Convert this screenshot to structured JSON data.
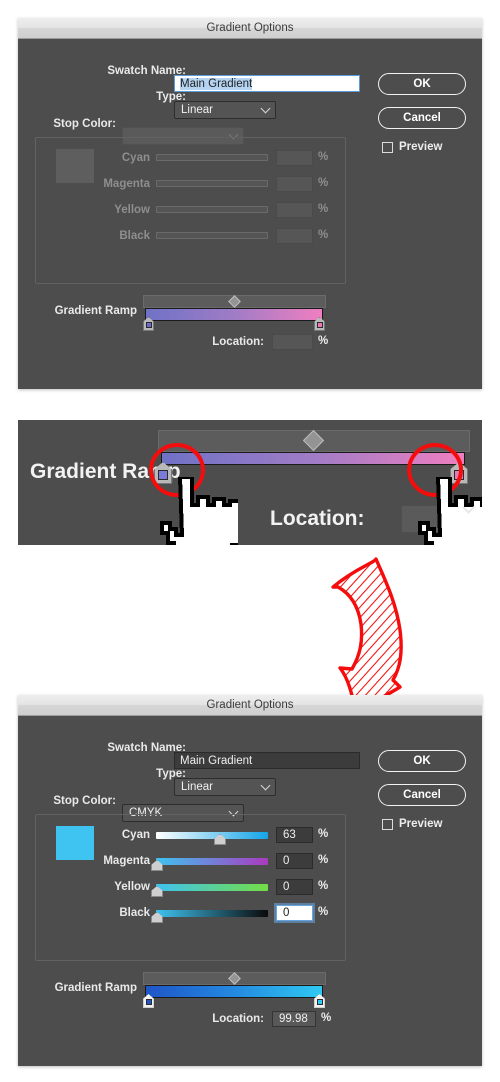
{
  "app": {
    "dialog_title": "Gradient Options"
  },
  "colors": {
    "dialog_bg": "#4d4d4d",
    "titlebar": "#e4e4e4",
    "accent_red": "#f50c0c",
    "swatch_cyan": "#3fc3f0",
    "top_ramp_start": "#6f72c6",
    "top_ramp_end": "#ef7fc0",
    "bottom_ramp_start": "#1f55c8",
    "bottom_ramp_end": "#2fc9f2",
    "selection_highlight": "#b4d4f2",
    "field_dark": "#3c3c3c",
    "label_disabled": "#8e8e8e"
  },
  "panel_top": {
    "title": "Gradient Options",
    "swatch_name_label": "Swatch Name:",
    "swatch_name_value": "Main Gradient",
    "swatch_name_selected": true,
    "type_label": "Type:",
    "type_value": "Linear",
    "stop_color_label": "Stop Color:",
    "stop_color_value": "",
    "stop_color_disabled": true,
    "ok_label": "OK",
    "cancel_label": "Cancel",
    "preview_label": "Preview",
    "preview_checked": false,
    "channels": [
      {
        "label": "Cyan",
        "value": "",
        "unit": "%",
        "disabled": true
      },
      {
        "label": "Magenta",
        "value": "",
        "unit": "%",
        "disabled": true
      },
      {
        "label": "Yellow",
        "value": "",
        "unit": "%",
        "disabled": true
      },
      {
        "label": "Black",
        "value": "",
        "unit": "%",
        "disabled": true
      }
    ],
    "gradient_ramp_label": "Gradient Ramp",
    "ramp_start_color": "#6f72c6",
    "ramp_end_color": "#ef7fc0",
    "stop_left_color": "#6a6ac8",
    "stop_right_color": "#e878b8",
    "location_label": "Location:",
    "location_value": "",
    "location_unit": "%"
  },
  "panel_middle": {
    "gradient_ramp_label": "Gradient Ramp",
    "location_label": "Location:",
    "location_value": "",
    "ramp_start_color": "#6f72c6",
    "ramp_end_color": "#ef7fc0",
    "stop_left_color": "#6a6ac8",
    "stop_right_color": "#e878b8",
    "annotation": {
      "circle_count": 2,
      "cursor_count": 2,
      "cursor_icon": "pointing-hand-cursor",
      "circle_color": "#f50c0c"
    }
  },
  "panel_bottom": {
    "title": "Gradient Options",
    "swatch_name_label": "Swatch Name:",
    "swatch_name_value": "Main Gradient",
    "swatch_name_selected": false,
    "type_label": "Type:",
    "type_value": "Linear",
    "stop_color_label": "Stop Color:",
    "stop_color_value": "CMYK",
    "stop_color_disabled": false,
    "ok_label": "OK",
    "cancel_label": "Cancel",
    "preview_label": "Preview",
    "preview_checked": false,
    "color_chip": "#3fc3f0",
    "channels": [
      {
        "label": "Cyan",
        "value": "63",
        "unit": "%",
        "slider_pct": 63,
        "track_from": "#ffffff",
        "track_to": "#14a5e8",
        "focused": false
      },
      {
        "label": "Magenta",
        "value": "0",
        "unit": "%",
        "slider_pct": 0,
        "track_from": "#3fc3f0",
        "track_to": "#a93bbf",
        "focused": false
      },
      {
        "label": "Yellow",
        "value": "0",
        "unit": "%",
        "slider_pct": 0,
        "track_from": "#3fc3f0",
        "track_to": "#73dd46",
        "focused": false
      },
      {
        "label": "Black",
        "value": "0",
        "unit": "%",
        "slider_pct": 0,
        "track_from": "#3fc3f0",
        "track_to": "#0a0a0a",
        "focused": true
      }
    ],
    "gradient_ramp_label": "Gradient Ramp",
    "ramp_start_color": "#1f55c8",
    "ramp_end_color": "#2fc9f2",
    "stop_left_color": "#1f55c8",
    "stop_right_color": "#2fc9f2",
    "location_label": "Location:",
    "location_value": "99.98",
    "location_unit": "%"
  },
  "annotation_arrow": {
    "name": "curved-down-arrow",
    "color": "#f50c0c",
    "style": "hand-drawn-hatched"
  }
}
